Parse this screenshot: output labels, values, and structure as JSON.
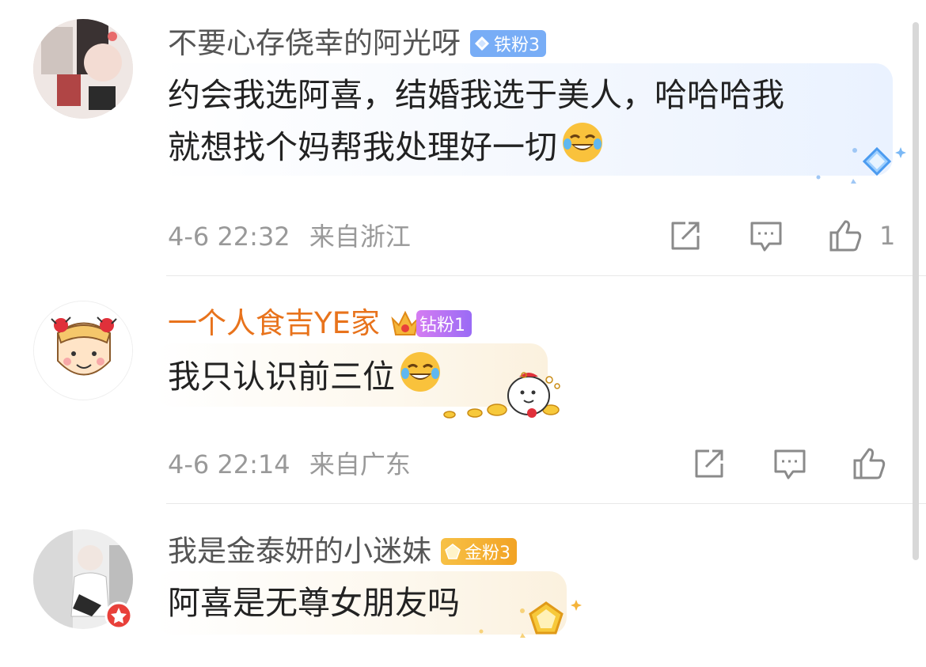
{
  "comments": [
    {
      "username": "不要心存侥幸的阿光呀",
      "badge": "铁粉3",
      "text_line1": "约会我选阿喜，结婚我选于美人，哈哈哈我",
      "text_line2": "就想找个妈帮我处理好一切",
      "emoji": "laugh-cry-emoji",
      "time": "4-6 22:32",
      "location": "来自浙江",
      "like_count": "1"
    },
    {
      "username": "一个人食吉YE家",
      "badge": "钻粉1",
      "text_line1": "我只认识前三位",
      "emoji": "laugh-cry-emoji",
      "time": "4-6 22:14",
      "location": "来自广东",
      "like_count": ""
    },
    {
      "username": "我是金泰妍的小迷妹",
      "badge": "金粉3",
      "text_line1": "阿喜是无尊女朋友吗"
    }
  ],
  "colors": {
    "username_default": "#555555",
    "username_vip": "#e8731c",
    "badge_iron": "#6fa8f5",
    "badge_diamond": "#c77af5",
    "badge_gold": "#f5b43a",
    "bubble_blue": "#eef5ff",
    "bubble_cream": "#fdf6e8",
    "meta_gray": "#999999"
  }
}
